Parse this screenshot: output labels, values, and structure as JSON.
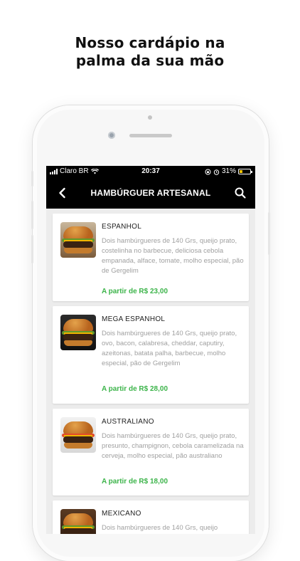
{
  "headline": {
    "line1": "Nosso cardápio na",
    "line2": "palma da sua mão"
  },
  "status_bar": {
    "carrier": "Claro BR",
    "time": "20:37",
    "battery": "31%",
    "battery_level": 0.31
  },
  "nav": {
    "title": "HAMBÚRGUER ARTESANAL",
    "back_icon": "chevron-left-icon",
    "search_icon": "search-icon"
  },
  "items": [
    {
      "name": "ESPANHOL",
      "description": "Dois hambúrgueres de 140 Grs, queijo prato, costelinha no barbecue, deliciosa cebola empanada, alface, tomate, molho especial, pão de Gergelim",
      "price": "A partir de R$ 23,00"
    },
    {
      "name": "MEGA ESPANHOL",
      "description": "Dois hambúrgueres de 140 Grs, queijo prato, ovo, bacon, calabresa, cheddar, caputiry, azeitonas, batata palha, barbecue, molho especial, pão de Gergelim",
      "price": "A partir de R$ 28,00"
    },
    {
      "name": "AUSTRALIANO",
      "description": "Dois hambúrgueres de 140 Grs, queijo prato, presunto, champignon, cebola caramelizada na cerveja, molho especial, pão australiano",
      "price": "A partir de R$ 18,00"
    },
    {
      "name": "MEXICANO",
      "description": "Dois hambúrgueres de 140 Grs, queijo",
      "price": ""
    }
  ],
  "colors": {
    "accent_price": "#3cb44a",
    "nav_bg": "#000000"
  }
}
